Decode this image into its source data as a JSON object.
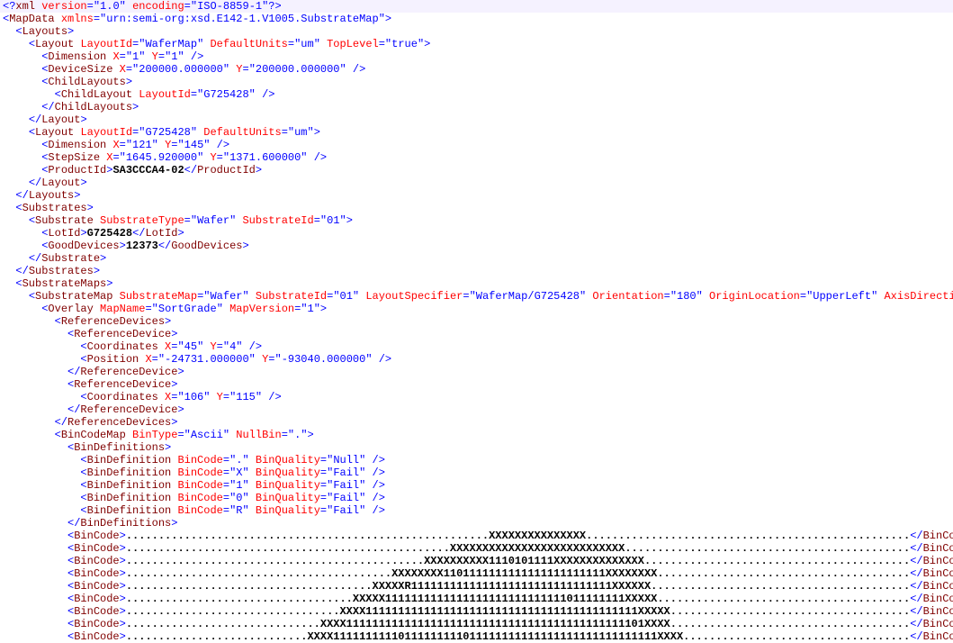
{
  "xmlDecl": {
    "version": "1.0",
    "encoding": "ISO-8859-1"
  },
  "mapData": {
    "xmlns": "urn:semi-org:xsd.E142-1.V1005.SubstrateMap"
  },
  "layouts": [
    {
      "LayoutId": "WaferMap",
      "DefaultUnits": "um",
      "TopLevel": "true",
      "Dimension": {
        "X": "1",
        "Y": "1"
      },
      "DeviceSize": {
        "X": "200000.000000",
        "Y": "200000.000000"
      },
      "ChildLayouts": [
        {
          "LayoutId": "G725428"
        }
      ]
    },
    {
      "LayoutId": "G725428",
      "DefaultUnits": "um",
      "Dimension": {
        "X": "121",
        "Y": "145"
      },
      "StepSize": {
        "X": "1645.920000",
        "Y": "1371.600000"
      },
      "ProductId": "SA3CCCA4-02"
    }
  ],
  "substrate": {
    "SubstrateType": "Wafer",
    "SubstrateId": "01",
    "LotId": "G725428",
    "GoodDevices": "12373"
  },
  "substrateMap": {
    "SubstrateMap": "Wafer",
    "SubstrateId": "01",
    "LayoutSpecifier": "WaferMap/G725428",
    "Orientation": "180",
    "OriginLocation": "UpperLeft",
    "AxisDirection": ""
  },
  "overlay": {
    "MapName": "SortGrade",
    "MapVersion": "1"
  },
  "refDevices": [
    {
      "Coordinates": {
        "X": "45",
        "Y": "4"
      },
      "Position": {
        "X": "-24731.000000",
        "Y": "-93040.000000"
      }
    },
    {
      "Coordinates": {
        "X": "106",
        "Y": "115"
      }
    }
  ],
  "binCodeMap": {
    "BinType": "Ascii",
    "NullBin": "."
  },
  "binDefs": [
    {
      "BinCode": ".",
      "BinQuality": "Null"
    },
    {
      "BinCode": "X",
      "BinQuality": "Fail"
    },
    {
      "BinCode": "1",
      "BinQuality": "Fail"
    },
    {
      "BinCode": "0",
      "BinQuality": "Fail"
    },
    {
      "BinCode": "R",
      "BinQuality": "Fail"
    }
  ],
  "binCodes": [
    "........................................................XXXXXXXXXXXXXXX..................................................",
    "..................................................XXXXXXXXXXXXXXXXXXXXXXXXXXX............................................",
    "..............................................XXXXXXXXXX1110101111XXXXXXXXXXXXXX.........................................",
    ".........................................XXXXXXXX1101111111111111111111111XXXXXXXX.......................................",
    "......................................XXXXXR1111111111111111111111111111111XXXXXX........................................",
    "...................................XXXXX1111111111111111111111111111011111111XXXXX.......................................",
    ".................................XXXX111111111111111111111111111111111111111111XXXXX.....................................",
    "..............................XXXX1111111111111111111111111111111111111111111101XXXX.....................................",
    "............................XXXX11111111110111111111011111111111111111111111111111XXXX..................................."
  ]
}
